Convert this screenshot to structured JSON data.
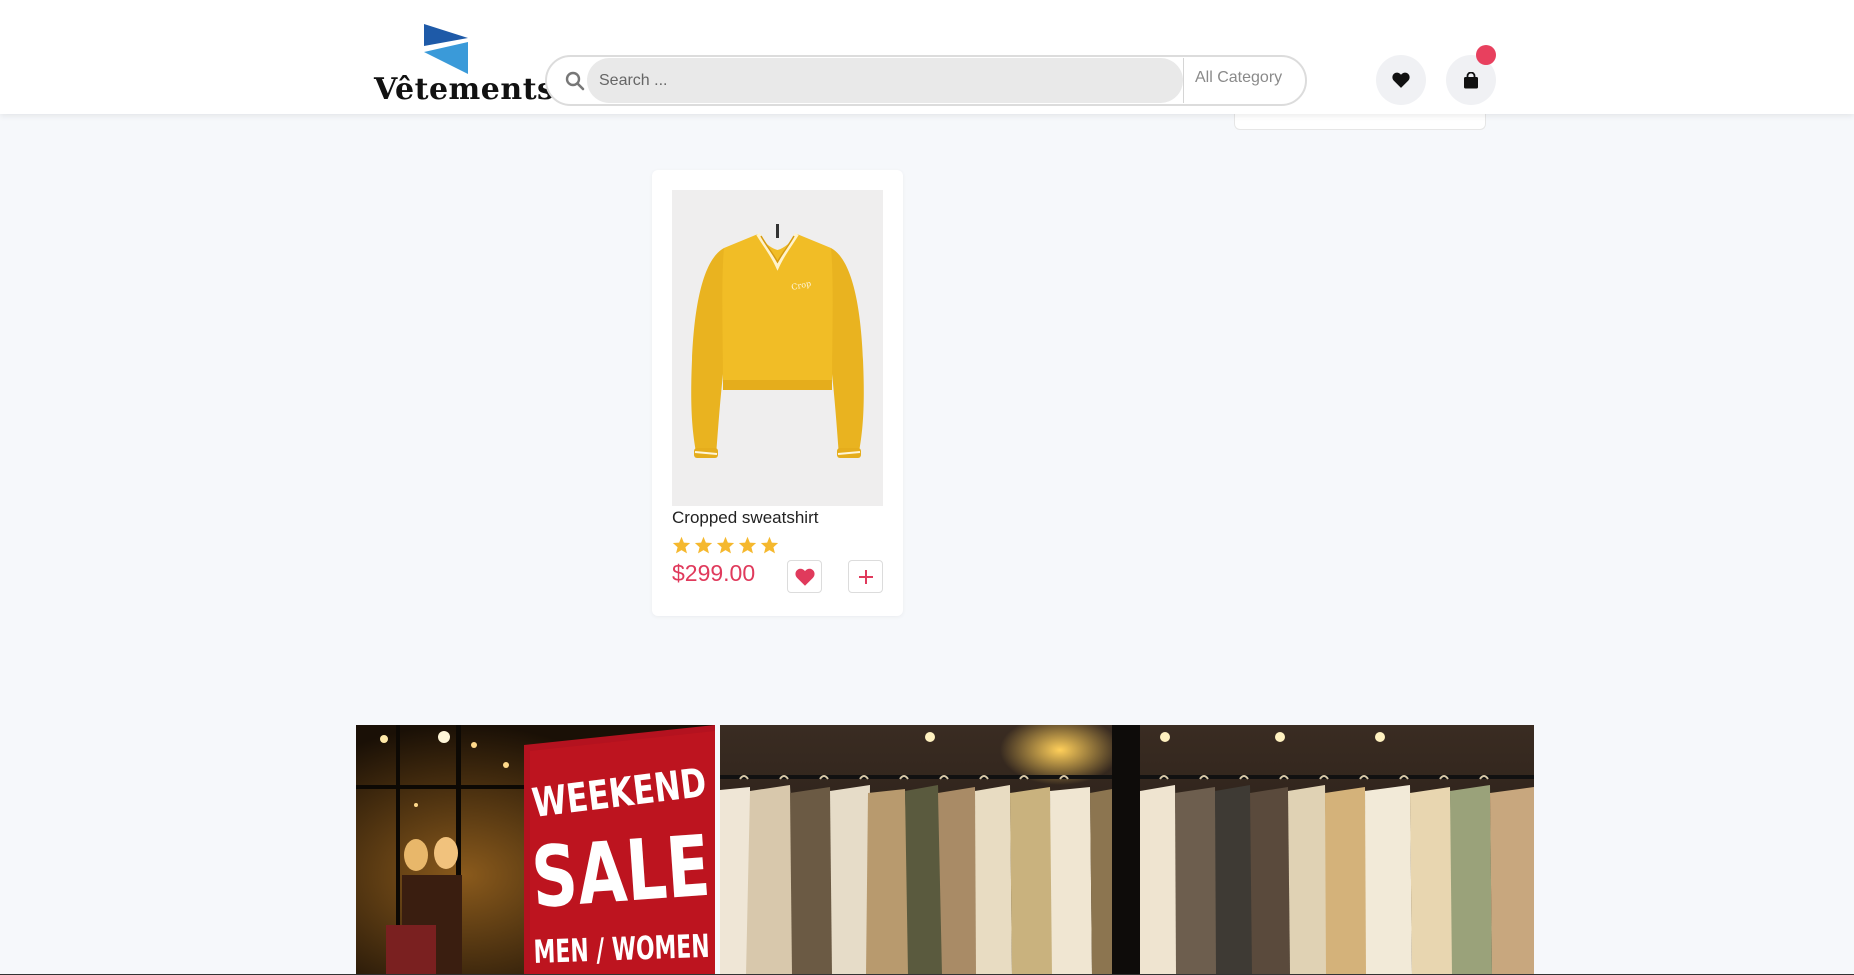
{
  "header": {
    "logo_text": "Vêtements",
    "search": {
      "placeholder": "Search ...",
      "value": ""
    },
    "category_label": "All Category",
    "icons": [
      "search-icon",
      "heart-icon",
      "shopping-bag-icon"
    ]
  },
  "product": {
    "title": "Cropped sweatshirt",
    "price": "$299.00",
    "rating": 5,
    "rating_max": 5,
    "image": "yellow cropped sweatshirt"
  },
  "banners": [
    {
      "name": "weekend-sale-banner",
      "line1": "WEEKEND",
      "line2": "SALE",
      "line3": "MEN / WOMEN"
    },
    {
      "name": "clothing-rack-banner"
    }
  ],
  "colors": {
    "accent": "#e03a5c",
    "cart_badge": "#e8405e",
    "star": "#f5b82e",
    "logo_dark_blue": "#1e5aa8",
    "logo_light_blue": "#3a9ad9"
  }
}
